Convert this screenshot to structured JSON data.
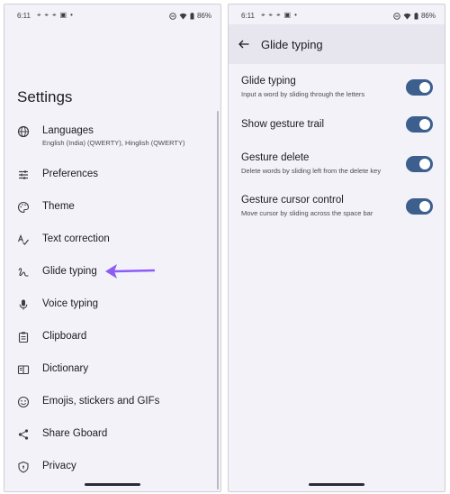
{
  "status": {
    "time": "6:11",
    "left_icons": [
      "⌖",
      "⌖",
      "⌖",
      "▣",
      "•"
    ],
    "battery": "86%"
  },
  "settings": {
    "title": "Settings",
    "items": [
      {
        "label": "Languages",
        "sublabel": "English (India) (QWERTY), Hinglish (QWERTY)",
        "icon": "globe-icon"
      },
      {
        "label": "Preferences",
        "icon": "sliders-icon"
      },
      {
        "label": "Theme",
        "icon": "palette-icon"
      },
      {
        "label": "Text correction",
        "icon": "spellcheck-icon"
      },
      {
        "label": "Glide typing",
        "icon": "gesture-icon"
      },
      {
        "label": "Voice typing",
        "icon": "microphone-icon"
      },
      {
        "label": "Clipboard",
        "icon": "clipboard-icon"
      },
      {
        "label": "Dictionary",
        "icon": "book-icon"
      },
      {
        "label": "Emojis, stickers and GIFs",
        "icon": "emoji-icon"
      },
      {
        "label": "Share Gboard",
        "icon": "share-icon"
      },
      {
        "label": "Privacy",
        "icon": "shield-icon"
      }
    ],
    "highlight_arrow_color": "#8b5cf6"
  },
  "glide": {
    "title": "Glide typing",
    "prefs": [
      {
        "title": "Glide typing",
        "subtitle": "Input a word by sliding through the letters",
        "enabled": true
      },
      {
        "title": "Show gesture trail",
        "subtitle": "",
        "enabled": true
      },
      {
        "title": "Gesture delete",
        "subtitle": "Delete words by sliding left from the delete key",
        "enabled": true
      },
      {
        "title": "Gesture cursor control",
        "subtitle": "Move cursor by sliding across the space bar",
        "enabled": true
      }
    ],
    "toggle_color": "#3c5f8e"
  }
}
